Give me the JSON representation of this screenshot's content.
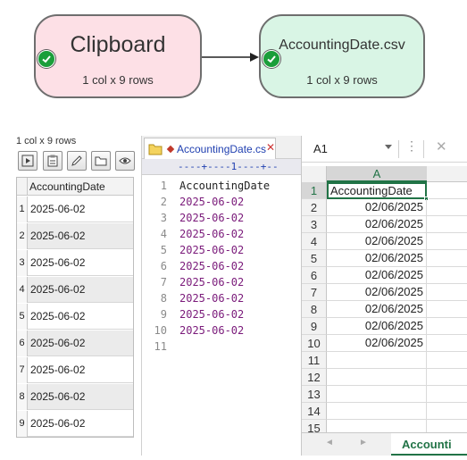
{
  "flow": {
    "clipboard_node": {
      "title": "Clipboard",
      "subtitle": "1 col x 9 rows",
      "status_icon": "check-circle-icon"
    },
    "csv_node": {
      "title": "AccountingDate.csv",
      "subtitle": "1 col x 9 rows",
      "status_icon": "check-circle-icon"
    },
    "colors": {
      "clipboard_fill": "#fde0e6",
      "csv_fill": "#d9f5e5",
      "check": "#1a9e3a"
    }
  },
  "left_panel": {
    "caption": "1 col x 9 rows",
    "toolbar": [
      "play-icon",
      "clipboard-icon",
      "pencil-icon",
      "folder-icon",
      "eye-icon"
    ],
    "column_header": "AccountingDate",
    "rows": [
      {
        "n": "1",
        "value": "2025-06-02"
      },
      {
        "n": "2",
        "value": "2025-06-02"
      },
      {
        "n": "3",
        "value": "2025-06-02"
      },
      {
        "n": "4",
        "value": "2025-06-02"
      },
      {
        "n": "5",
        "value": "2025-06-02"
      },
      {
        "n": "6",
        "value": "2025-06-02"
      },
      {
        "n": "7",
        "value": "2025-06-02"
      },
      {
        "n": "8",
        "value": "2025-06-02"
      },
      {
        "n": "9",
        "value": "2025-06-02"
      }
    ]
  },
  "editor": {
    "tab_name": "AccountingDate.csv",
    "tab_close": "✕",
    "ruler": "----+----1----+--",
    "lines": [
      {
        "n": "1",
        "text": "AccountingDate"
      },
      {
        "n": "2",
        "text": "2025-06-02"
      },
      {
        "n": "3",
        "text": "2025-06-02"
      },
      {
        "n": "4",
        "text": "2025-06-02"
      },
      {
        "n": "5",
        "text": "2025-06-02"
      },
      {
        "n": "6",
        "text": "2025-06-02"
      },
      {
        "n": "7",
        "text": "2025-06-02"
      },
      {
        "n": "8",
        "text": "2025-06-02"
      },
      {
        "n": "9",
        "text": "2025-06-02"
      },
      {
        "n": "10",
        "text": "2025-06-02"
      },
      {
        "n": "11",
        "text": ""
      }
    ]
  },
  "spreadsheet": {
    "name_box": "A1",
    "more_icon": "⋮",
    "close_icon": "✕",
    "column_header": "A",
    "rows": [
      {
        "n": "1",
        "value": "AccountingDate"
      },
      {
        "n": "2",
        "value": "02/06/2025"
      },
      {
        "n": "3",
        "value": "02/06/2025"
      },
      {
        "n": "4",
        "value": "02/06/2025"
      },
      {
        "n": "5",
        "value": "02/06/2025"
      },
      {
        "n": "6",
        "value": "02/06/2025"
      },
      {
        "n": "7",
        "value": "02/06/2025"
      },
      {
        "n": "8",
        "value": "02/06/2025"
      },
      {
        "n": "9",
        "value": "02/06/2025"
      },
      {
        "n": "10",
        "value": "02/06/2025"
      },
      {
        "n": "11",
        "value": ""
      },
      {
        "n": "12",
        "value": ""
      },
      {
        "n": "13",
        "value": ""
      },
      {
        "n": "14",
        "value": ""
      },
      {
        "n": "15",
        "value": ""
      }
    ],
    "sheet_tab": "Accounti",
    "accent": "#217346"
  }
}
